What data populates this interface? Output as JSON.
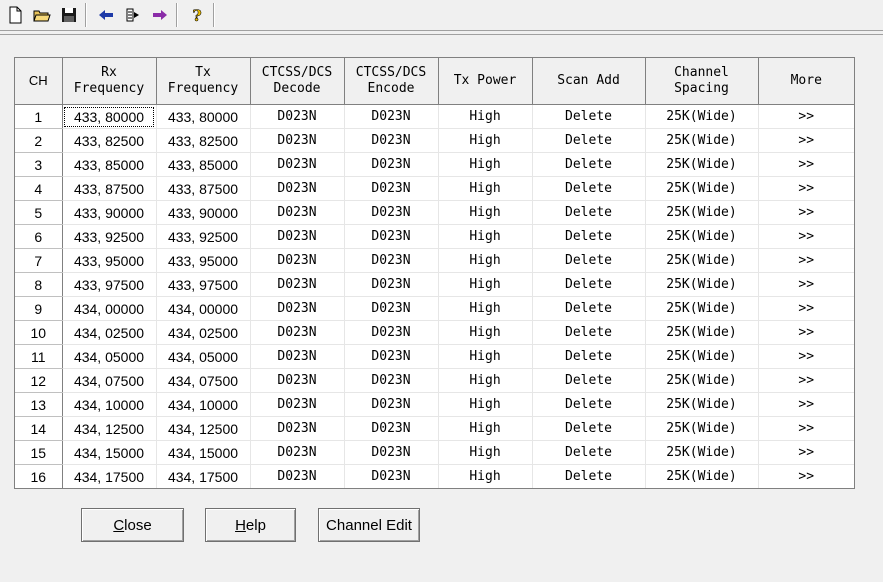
{
  "toolbar": {
    "icons": [
      "new-file-icon",
      "open-folder-icon",
      "save-icon",
      "read-from-radio-icon",
      "write-to-radio-icon",
      "arrow-right-icon",
      "help-icon"
    ]
  },
  "grid": {
    "columns": [
      {
        "line1": "CH",
        "line2": ""
      },
      {
        "line1": "Rx",
        "line2": "Frequency"
      },
      {
        "line1": "Tx",
        "line2": "Frequency"
      },
      {
        "line1": "CTCSS/DCS",
        "line2": "Decode"
      },
      {
        "line1": "CTCSS/DCS",
        "line2": "Encode"
      },
      {
        "line1": "Tx Power",
        "line2": ""
      },
      {
        "line1": "Scan Add",
        "line2": ""
      },
      {
        "line1": "Channel",
        "line2": "Spacing"
      },
      {
        "line1": "More",
        "line2": ""
      }
    ],
    "rows": [
      [
        "1",
        "433, 80000",
        "433, 80000",
        "D023N",
        "D023N",
        "High",
        "Delete",
        "25K(Wide)",
        ">>"
      ],
      [
        "2",
        "433, 82500",
        "433, 82500",
        "D023N",
        "D023N",
        "High",
        "Delete",
        "25K(Wide)",
        ">>"
      ],
      [
        "3",
        "433, 85000",
        "433, 85000",
        "D023N",
        "D023N",
        "High",
        "Delete",
        "25K(Wide)",
        ">>"
      ],
      [
        "4",
        "433, 87500",
        "433, 87500",
        "D023N",
        "D023N",
        "High",
        "Delete",
        "25K(Wide)",
        ">>"
      ],
      [
        "5",
        "433, 90000",
        "433, 90000",
        "D023N",
        "D023N",
        "High",
        "Delete",
        "25K(Wide)",
        ">>"
      ],
      [
        "6",
        "433, 92500",
        "433, 92500",
        "D023N",
        "D023N",
        "High",
        "Delete",
        "25K(Wide)",
        ">>"
      ],
      [
        "7",
        "433, 95000",
        "433, 95000",
        "D023N",
        "D023N",
        "High",
        "Delete",
        "25K(Wide)",
        ">>"
      ],
      [
        "8",
        "433, 97500",
        "433, 97500",
        "D023N",
        "D023N",
        "High",
        "Delete",
        "25K(Wide)",
        ">>"
      ],
      [
        "9",
        "434, 00000",
        "434, 00000",
        "D023N",
        "D023N",
        "High",
        "Delete",
        "25K(Wide)",
        ">>"
      ],
      [
        "10",
        "434, 02500",
        "434, 02500",
        "D023N",
        "D023N",
        "High",
        "Delete",
        "25K(Wide)",
        ">>"
      ],
      [
        "11",
        "434, 05000",
        "434, 05000",
        "D023N",
        "D023N",
        "High",
        "Delete",
        "25K(Wide)",
        ">>"
      ],
      [
        "12",
        "434, 07500",
        "434, 07500",
        "D023N",
        "D023N",
        "High",
        "Delete",
        "25K(Wide)",
        ">>"
      ],
      [
        "13",
        "434, 10000",
        "434, 10000",
        "D023N",
        "D023N",
        "High",
        "Delete",
        "25K(Wide)",
        ">>"
      ],
      [
        "14",
        "434, 12500",
        "434, 12500",
        "D023N",
        "D023N",
        "High",
        "Delete",
        "25K(Wide)",
        ">>"
      ],
      [
        "15",
        "434, 15000",
        "434, 15000",
        "D023N",
        "D023N",
        "High",
        "Delete",
        "25K(Wide)",
        ">>"
      ],
      [
        "16",
        "434, 17500",
        "434, 17500",
        "D023N",
        "D023N",
        "High",
        "Delete",
        "25K(Wide)",
        ">>"
      ]
    ]
  },
  "buttons": {
    "close": {
      "mnemonic": "C",
      "rest": "lose"
    },
    "help": {
      "mnemonic": "H",
      "rest": "elp"
    },
    "channel_edit": "Channel Edit"
  }
}
